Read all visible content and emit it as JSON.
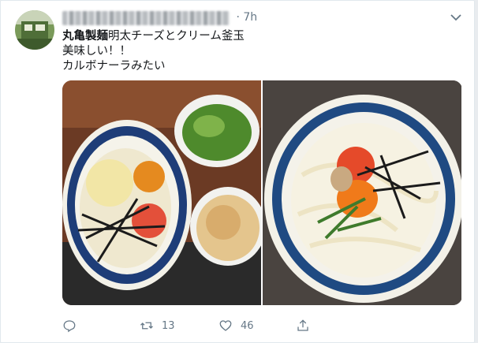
{
  "tweet": {
    "time": "7h",
    "text_bold": "丸亀製麺",
    "text_line1_rest": "明太チーズとクリーム釜玉",
    "text_line2": "美味しい！！",
    "text_line3": "カルボナーラみたい"
  },
  "actions": {
    "reply_icon": "reply-icon",
    "retweet_count": "13",
    "like_count": "46",
    "share_icon": "share-icon"
  },
  "colors": {
    "muted_text": "#657786",
    "body_text": "#14171a",
    "border": "#e1e8ed"
  }
}
